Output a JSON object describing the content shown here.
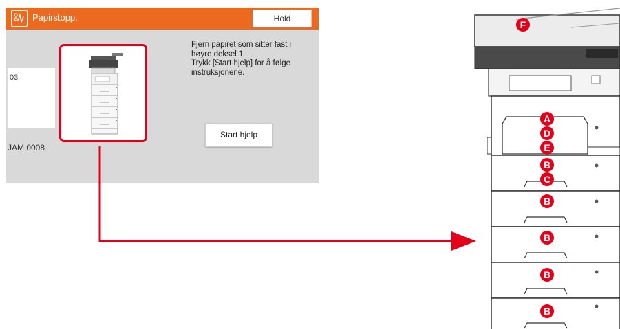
{
  "screen": {
    "title": "Papirstopp.",
    "hold_label": "Hold",
    "jam_code": "03",
    "jam_label": "JAM 0008",
    "instructions": [
      "Fjern papiret som sitter fast i",
      "høyre deksel 1.",
      "Trykk [Start hjelp] for å følge",
      "instruksjonene."
    ],
    "start_help_label": "Start hjelp"
  },
  "device_callouts": [
    "F",
    "A",
    "D",
    "E",
    "B",
    "C",
    "B",
    "B",
    "B",
    "B"
  ],
  "colors": {
    "title_bar": "#ec6a1f",
    "panel": "#d9d9d9",
    "highlight": "#e3001b"
  }
}
